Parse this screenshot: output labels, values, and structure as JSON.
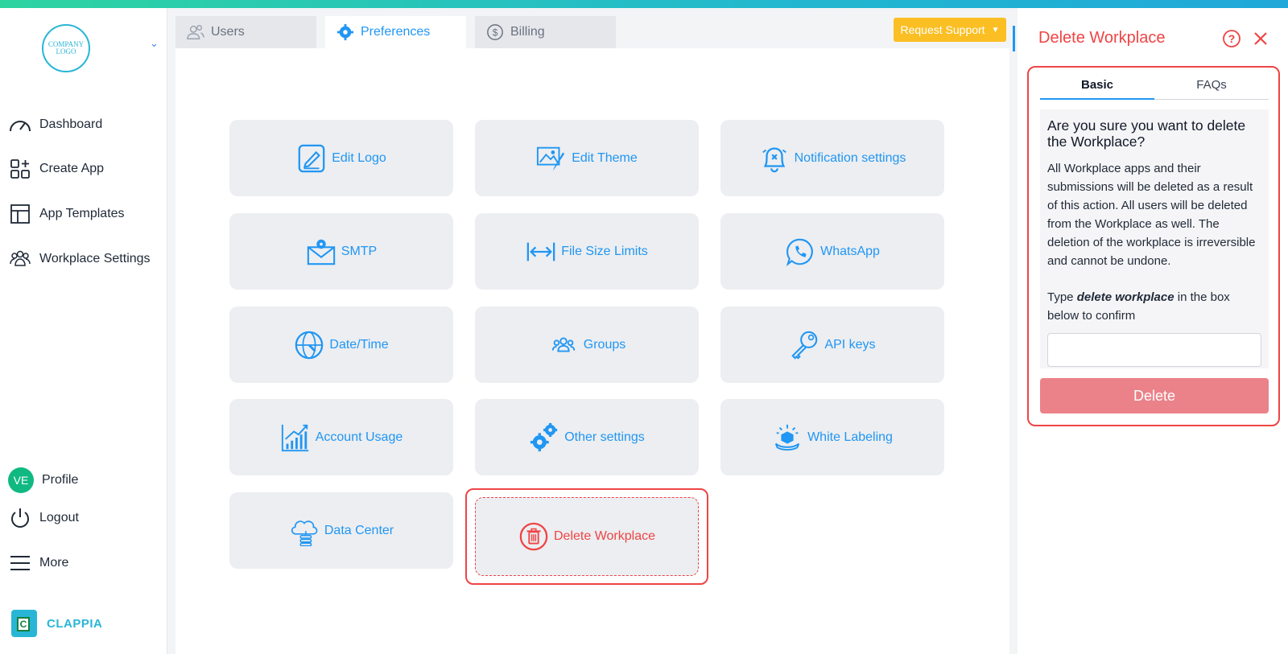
{
  "sidebar": {
    "logo_text": "COMPANY LOGO",
    "nav": [
      {
        "label": "Dashboard",
        "icon": "speedometer-icon"
      },
      {
        "label": "Create App",
        "icon": "grid-plus-icon"
      },
      {
        "label": "App Templates",
        "icon": "layout-icon"
      },
      {
        "label": "Workplace Settings",
        "icon": "people-icon"
      }
    ],
    "bottom": [
      {
        "label": "Profile",
        "avatar": "VE"
      },
      {
        "label": "Logout",
        "icon": "power-icon"
      },
      {
        "label": "More",
        "icon": "menu-icon"
      }
    ],
    "brand": "CLAPPIA"
  },
  "tabs": [
    {
      "label": "Users",
      "icon": "users-icon"
    },
    {
      "label": "Preferences",
      "icon": "gear-icon"
    },
    {
      "label": "Billing",
      "icon": "dollar-icon"
    }
  ],
  "support_button": "Request Support",
  "cards": [
    {
      "label": "Edit Logo",
      "icon": "edit-logo-icon"
    },
    {
      "label": "Edit Theme",
      "icon": "theme-icon"
    },
    {
      "label": "Notification settings",
      "icon": "bell-icon"
    },
    {
      "label": "SMTP",
      "icon": "mail-gear-icon"
    },
    {
      "label": "File Size Limits",
      "icon": "arrows-horizontal-icon"
    },
    {
      "label": "WhatsApp",
      "icon": "whatsapp-icon"
    },
    {
      "label": "Date/Time",
      "icon": "globe-clock-icon"
    },
    {
      "label": "Groups",
      "icon": "groups-icon"
    },
    {
      "label": "API keys",
      "icon": "key-icon"
    },
    {
      "label": "Account Usage",
      "icon": "chart-icon"
    },
    {
      "label": "Other settings",
      "icon": "gears-icon"
    },
    {
      "label": "White Labeling",
      "icon": "label-icon"
    },
    {
      "label": "Data Center",
      "icon": "cloud-database-icon"
    },
    {
      "label": "Delete Workplace",
      "icon": "trash-icon"
    }
  ],
  "panel": {
    "title": "Delete Workplace",
    "tabs": [
      "Basic",
      "FAQs"
    ],
    "question": "Are you sure you want to delete the Workplace?",
    "description": "All Workplace apps and their submissions will be deleted as a result of this action. All users will be deleted from the Workplace as well. The deletion of the workplace is irreversible and cannot be undone.",
    "confirm_prefix": "Type ",
    "confirm_keyword": "delete workplace",
    "confirm_suffix": " in the box below to confirm",
    "input_value": "",
    "delete_label": "Delete"
  },
  "colors": {
    "accent": "#2196f3",
    "danger": "#ef4444",
    "support": "#fbbf24",
    "delete_btn": "#eb8289"
  }
}
